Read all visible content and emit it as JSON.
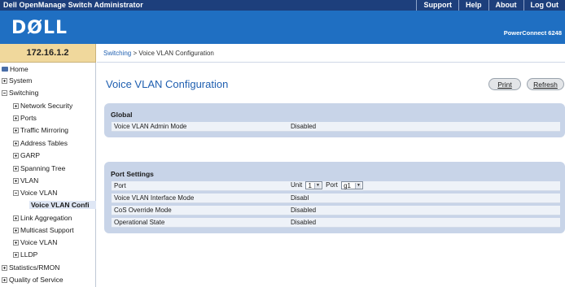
{
  "app": {
    "title": "Dell OpenManage Switch Administrator",
    "links": [
      "Support",
      "Help",
      "About",
      "Log Out"
    ],
    "logo": "DØLL",
    "product": "PowerConnect 6248"
  },
  "ip": "172.16.1.2",
  "breadcrumb": {
    "link": "Switching",
    "separator": " > ",
    "current": "Voice VLAN Configuration"
  },
  "sidebar": {
    "home": "Home",
    "items": [
      {
        "label": "System",
        "icon": "plus"
      },
      {
        "label": "Switching",
        "icon": "minus"
      },
      {
        "label": "Network Security",
        "icon": "plus"
      },
      {
        "label": "Ports",
        "icon": "plus"
      },
      {
        "label": "Traffic Mirroring",
        "icon": "plus"
      },
      {
        "label": "Address Tables",
        "icon": "plus"
      },
      {
        "label": "GARP",
        "icon": "plus"
      },
      {
        "label": "Spanning Tree",
        "icon": "plus"
      },
      {
        "label": "VLAN",
        "icon": "plus"
      },
      {
        "label": "Voice VLAN",
        "icon": "minus"
      },
      {
        "label": "Voice VLAN Confi",
        "icon": ""
      },
      {
        "label": "Link Aggregation",
        "icon": "plus"
      },
      {
        "label": "Multicast Support",
        "icon": "plus"
      },
      {
        "label": "Voice VLAN",
        "icon": "plus"
      },
      {
        "label": "LLDP",
        "icon": "plus"
      },
      {
        "label": "Statistics/RMON",
        "icon": "plus"
      },
      {
        "label": "Quality of Service",
        "icon": "plus"
      }
    ]
  },
  "main": {
    "title": "Voice VLAN Configuration",
    "print_label": "Print",
    "refresh_label": "Refresh",
    "global": {
      "title": "Global",
      "admin_mode_label": "Voice VLAN Admin Mode",
      "admin_mode_value": "Disabled"
    },
    "port_settings": {
      "title": "Port Settings",
      "port_label": "Port",
      "unit_label": "Unit",
      "unit_value": "1",
      "port_select_label": "Port",
      "port_value": "g1",
      "interface_mode_label": "Voice VLAN Interface Mode",
      "interface_mode_value": "Disabl",
      "cos_label": "CoS Override Mode",
      "cos_value": "Disabled",
      "oper_label": "Operational State",
      "oper_value": "Disabled"
    }
  },
  "colors": {
    "topbar": "#1d3f7c",
    "header": "#1f6fc2",
    "ip_box": "#f0d89c",
    "section": "#c8d4e8",
    "accent_text": "#1f5fb0"
  }
}
